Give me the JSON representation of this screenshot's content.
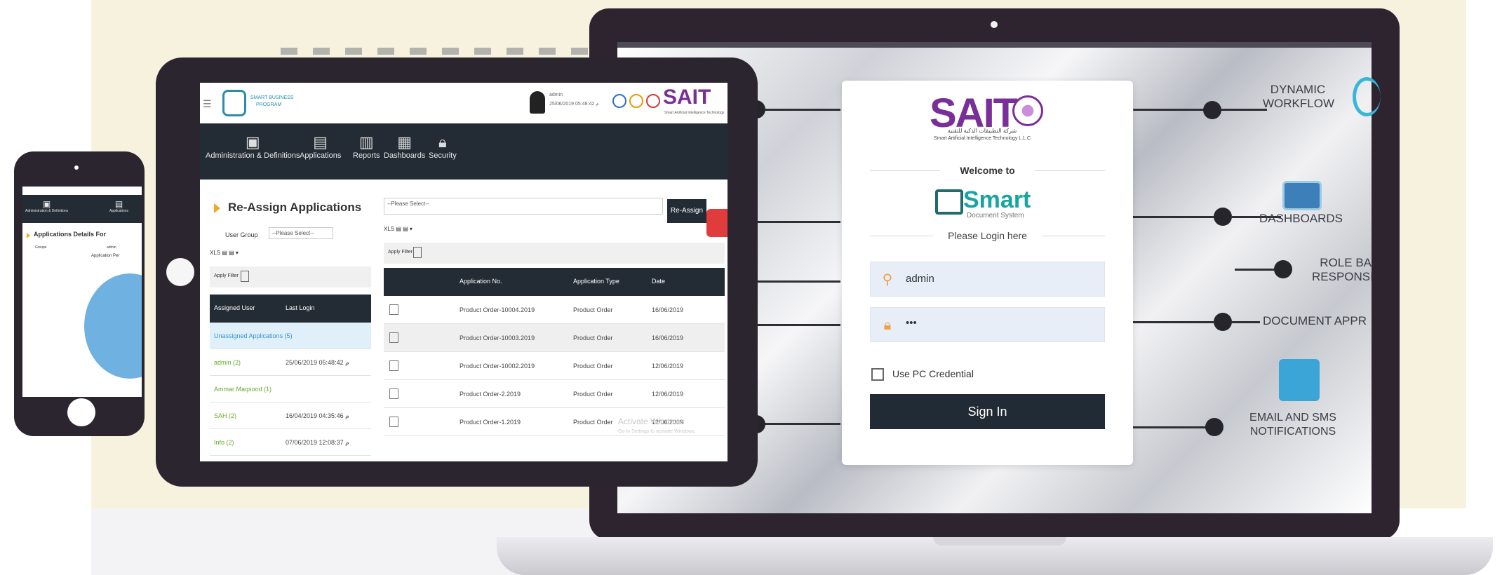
{
  "laptop": {
    "login": {
      "brand": "SAIT",
      "brand_sub_ar": "شركة التطبيقات الذكية للتقنية",
      "brand_sub_en": "Smart Artificial Intelligence Technology L.L.C",
      "welcome": "Welcome to",
      "product_name": "Smart",
      "product_sub": "Document System",
      "please_login": "Please Login here",
      "username_value": "admin",
      "password_value": "•••",
      "pc_credential_label": "Use PC Credential",
      "signin_label": "Sign In"
    },
    "features": [
      {
        "line1": "DYNAMIC",
        "line2": "WORKFLOW",
        "icon": "gear-icon"
      },
      {
        "line1": "DASHBOARDS",
        "line2": "",
        "icon": "dashboard-icon"
      },
      {
        "line1": "ROLE BA",
        "line2": "RESPONSI",
        "icon": ""
      },
      {
        "line1": "DOCUMENT APPR",
        "line2": "",
        "icon": ""
      },
      {
        "line1": "EMAIL AND SMS",
        "line2": "NOTIFICATIONS",
        "icon": "phone-notification-icon"
      }
    ],
    "colors": {
      "accent": "#7a2f98",
      "teal": "#18a5a1",
      "dark": "#212b35",
      "field": "#e7eef8"
    }
  },
  "tablet": {
    "header": {
      "logo_text1": "SMART BUSINESS",
      "logo_text2": "PROGRAM",
      "user_name": "admin",
      "user_time": "25/06/2019 05:48:42 م",
      "brand": "SAIT",
      "brand_sub": "Smart Artificial Intelligence Technology"
    },
    "nav": [
      {
        "label": "Administration & Definitions",
        "icon": "admin-icon"
      },
      {
        "label": "Applications",
        "icon": "applications-icon"
      },
      {
        "label": "Reports",
        "icon": "reports-icon"
      },
      {
        "label": "Dashboards",
        "icon": "dashboards-icon"
      },
      {
        "label": "Security",
        "icon": "security-icon"
      }
    ],
    "page_title": "Re-Assign Applications",
    "user_group_label": "User Group",
    "select_placeholder": "--Please Select--",
    "reassign_label": "Re-Assign",
    "apply_filter": "Apply Filter",
    "left_table": {
      "headers": [
        "Assigned User",
        "Last Login"
      ],
      "rows": [
        {
          "user": "Unassigned Applications (5)",
          "login": ""
        },
        {
          "user": "admin (2)",
          "login": "25/06/2019 05:48:42 م"
        },
        {
          "user": "Ammar Maqsood (1)",
          "login": ""
        },
        {
          "user": "SAH (2)",
          "login": "16/04/2019 04:35:46 م"
        },
        {
          "user": "Info (2)",
          "login": "07/06/2019 12:08:37 م"
        }
      ]
    },
    "right_table": {
      "headers": [
        "Application No.",
        "Application Type",
        "Date"
      ],
      "rows": [
        {
          "no": "Product Order-10004.2019",
          "type": "Product Order",
          "date": "16/06/2019"
        },
        {
          "no": "Product Order-10003.2019",
          "type": "Product Order",
          "date": "16/06/2019"
        },
        {
          "no": "Product Order-10002.2019",
          "type": "Product Order",
          "date": "12/06/2019"
        },
        {
          "no": "Product Order-2.2019",
          "type": "Product Order",
          "date": "12/06/2019"
        },
        {
          "no": "Product Order-1.2019",
          "type": "Product Order",
          "date": "12/06/2019"
        }
      ]
    },
    "watermark1": "Activate Windows",
    "watermark2": "Go to Settings to activate Windows."
  },
  "phone": {
    "nav": [
      "Administration & Definitions",
      "Applications"
    ],
    "title": "Applications Details For",
    "groups_label": "Groups",
    "select_value": "admin",
    "chart_title": "Application Per"
  }
}
